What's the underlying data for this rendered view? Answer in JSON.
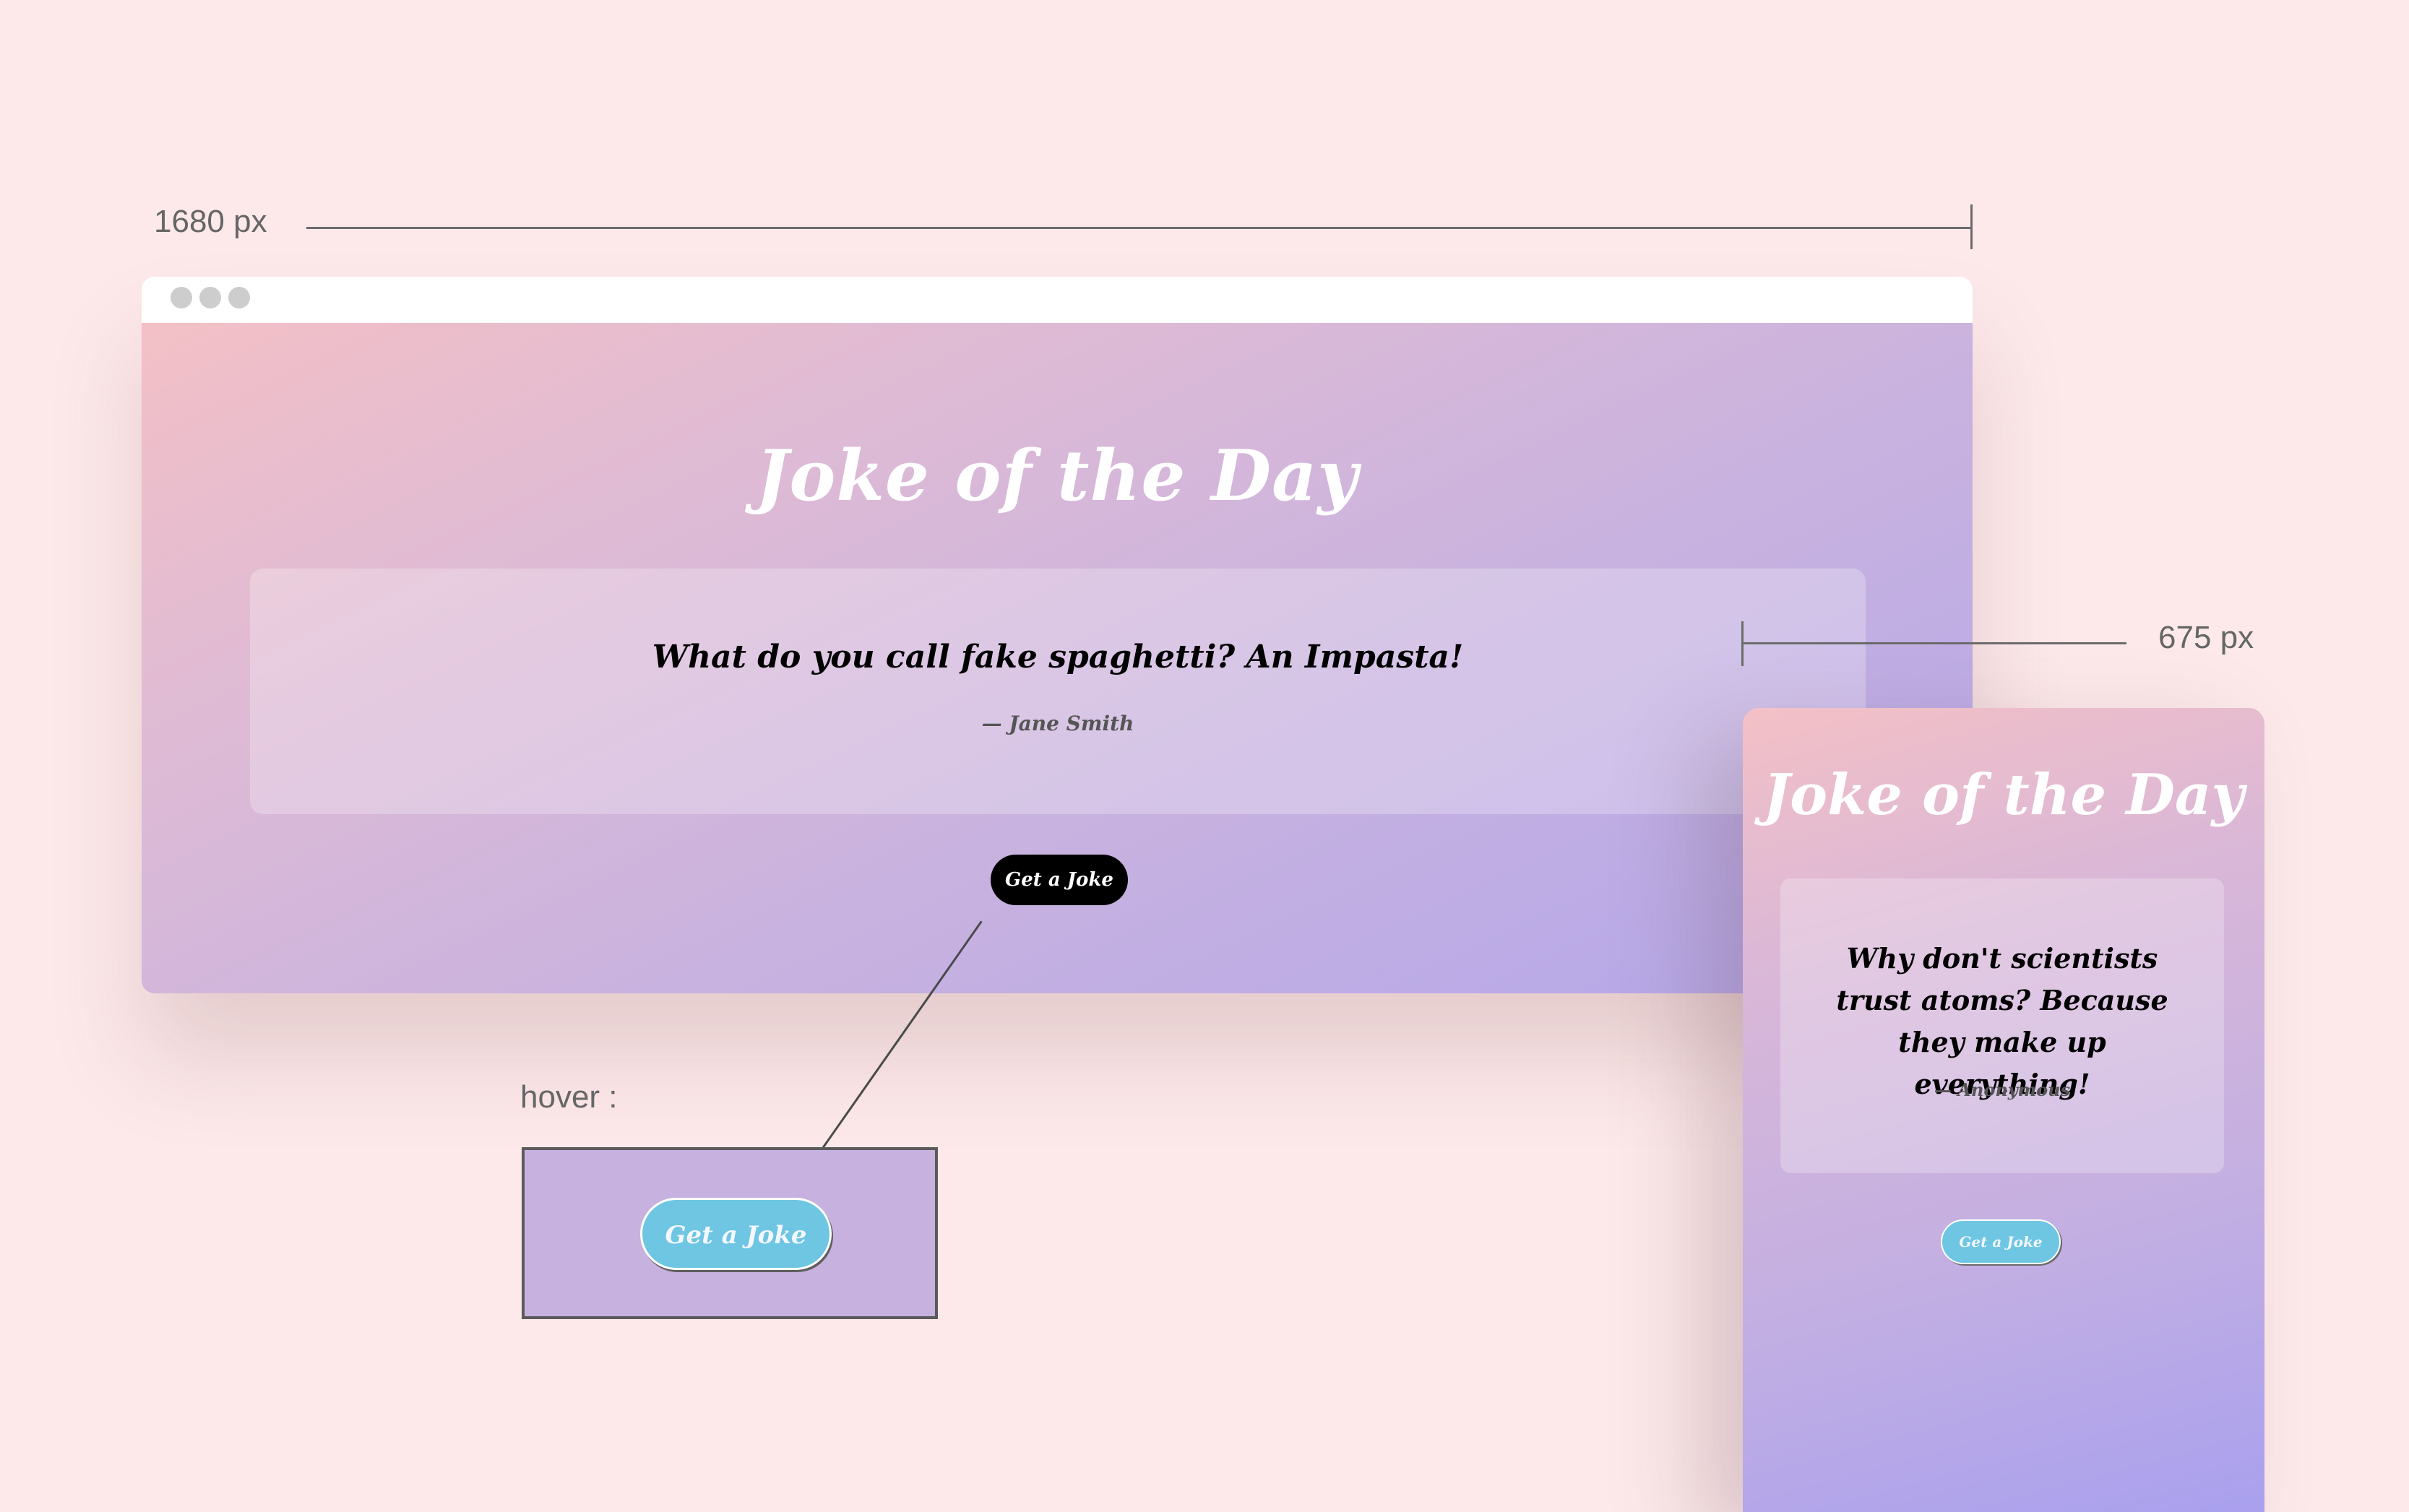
{
  "annotations": {
    "desktop_width": "1680 px",
    "mobile_width": "675 px",
    "hover_label": "hover :"
  },
  "desktop": {
    "title": "Joke of the Day",
    "joke": "What do you call fake spaghetti? An Impasta!",
    "author": "— Jane Smith",
    "button_label": "Get a Joke"
  },
  "hover": {
    "button_label": "Get a Joke"
  },
  "mobile": {
    "title": "Joke of the Day",
    "joke": "Why don't scientists trust atoms? Because they make up everything!",
    "author": "— Anonymous",
    "button_label": "Get a Joke"
  },
  "colors": {
    "background": "#fde9ea",
    "gradient_start": "#f3c0c6",
    "gradient_end": "#b3a6ea",
    "button_default": "#000000",
    "button_hover": "#6ec6e2"
  }
}
